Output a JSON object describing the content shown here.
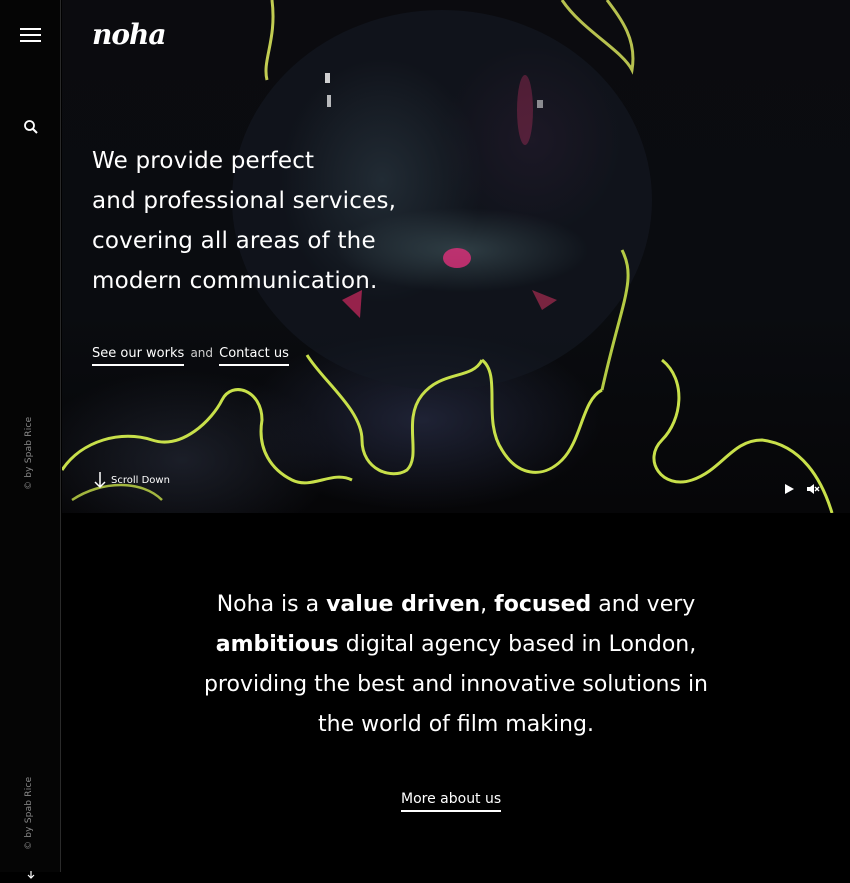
{
  "brand": {
    "logo_text": "noha"
  },
  "sidebar": {
    "menu_icon": "hamburger-menu-icon",
    "search_icon": "search-icon",
    "credit_top": "© by Spab Rice",
    "credit_bottom": "© by Spab Rice"
  },
  "hero": {
    "headline_lines": [
      "We provide perfect",
      "and professional services,",
      "covering all areas of the",
      "modern communication."
    ],
    "cta_works": "See our works",
    "cta_and": "and",
    "cta_contact": "Contact us",
    "scroll_label": "Scroll Down",
    "play_icon": "play-icon",
    "mute_icon": "mute-icon"
  },
  "intro": {
    "p1": "Noha is a ",
    "b1": "value driven",
    "p2": ", ",
    "b2": "focused",
    "p3": " and very",
    "b3": "ambitious",
    "p4": " digital agency based in London,",
    "line3": "providing the best and innovative solutions in",
    "line4": "the world of film making.",
    "more_label": "More about us"
  },
  "colors": {
    "background": "#000000",
    "text": "#ffffff",
    "muted": "#8a8a8a",
    "neon": "#c8e04a"
  }
}
